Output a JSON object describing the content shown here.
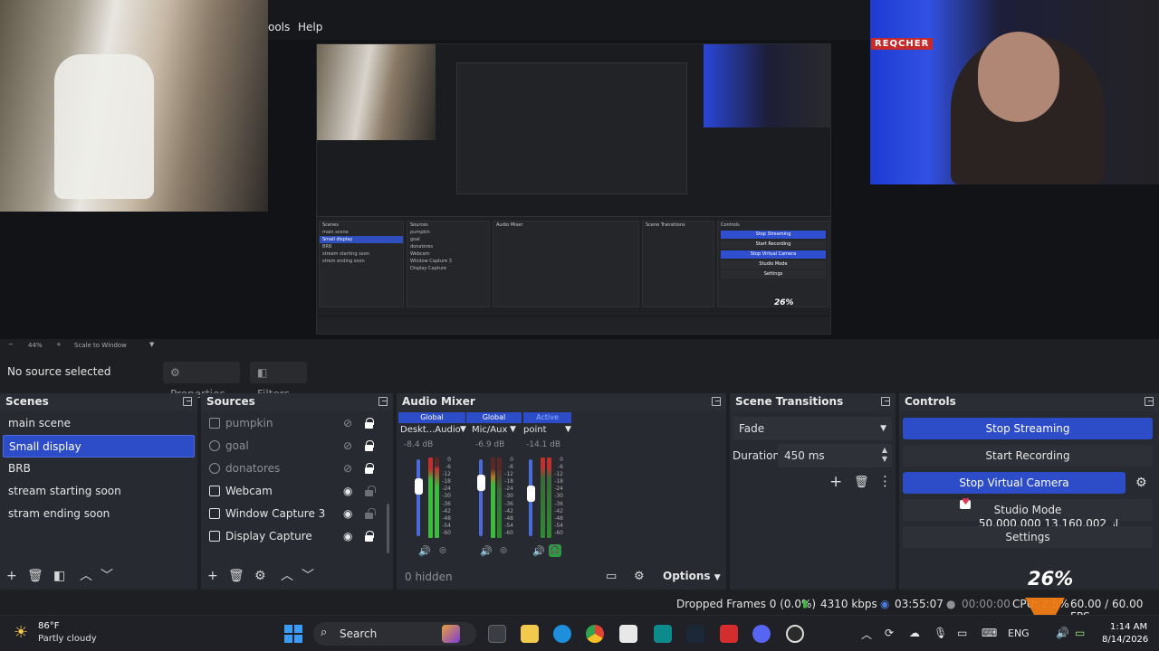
{
  "menu": {
    "tools_fragment": "ools",
    "help": "Help"
  },
  "camera": {
    "tag": "REQCHER"
  },
  "inner_preview": {
    "scenes_title": "Scenes",
    "sources_title": "Sources",
    "mixer_title": "Audio Mixer",
    "transitions_title": "Scene Transitions",
    "controls_title": "Controls",
    "scenes": [
      "main scene",
      "Small display",
      "BRB",
      "stream starting soon",
      "strem ending soon"
    ],
    "sources": [
      "pumpkin",
      "goal",
      "donatores",
      "Webcam",
      "Window Capture 3",
      "Display Capture"
    ],
    "controls": [
      "Stop Streaming",
      "Start Recording",
      "Stop Virtual Camera",
      "Studio Mode",
      "Settings"
    ],
    "percent": "26%"
  },
  "zoom": {
    "minus": "−",
    "level": "44%",
    "plus": "+",
    "mode": "Scale to Window"
  },
  "context": {
    "no_source": "No source selected",
    "properties": "Properties",
    "filters": "Filters"
  },
  "scenes": {
    "title": "Scenes",
    "items": [
      "main scene",
      "Small display",
      "BRB",
      "stream starting soon",
      "stram ending soon"
    ]
  },
  "sources": {
    "title": "Sources",
    "items": [
      {
        "label": "pumpkin",
        "icon": "image-icon"
      },
      {
        "label": "goal",
        "icon": "browser-icon"
      },
      {
        "label": "donatores",
        "icon": "browser-icon"
      },
      {
        "label": "Webcam",
        "icon": "camera-icon"
      },
      {
        "label": "Window Capture 3",
        "icon": "window-icon"
      },
      {
        "label": "Display Capture",
        "icon": "monitor-icon"
      }
    ]
  },
  "mixer": {
    "title": "Audio Mixer",
    "channels": [
      {
        "tag": "Global",
        "name": "Deskt...Audio",
        "db": "-8.4 dB"
      },
      {
        "tag": "Global",
        "name": "Mic/Aux",
        "db": "-6.9 dB"
      },
      {
        "tag": "Active",
        "name": "point",
        "db": "-14.1 dB"
      }
    ],
    "scale": [
      "0",
      "-6",
      "-12",
      "-18",
      "-24",
      "-30",
      "-36",
      "-42",
      "-48",
      "-54",
      "-60"
    ],
    "hidden": "0 hidden",
    "options": "Options"
  },
  "transitions": {
    "title": "Scene Transitions",
    "selected": "Fade",
    "duration_label": "Duration",
    "duration_value": "450 ms"
  },
  "controls": {
    "title": "Controls",
    "stop_streaming": "Stop Streaming",
    "start_recording": "Start Recording",
    "stop_virtual_camera": "Stop Virtual Camera",
    "studio_mode": "Studio Mode",
    "overlay_line": "50,000,000 از 13,160,002 تومان",
    "settings": "Settings",
    "cpu_overlay": "26%"
  },
  "status": {
    "dropped_frames": "Dropped Frames 0 (0.0%)",
    "bitrate": "4310 kbps",
    "stream_time": "03:55:07",
    "record_time": "00:00:00",
    "cpu": "CPU: 2.5%",
    "fps": "60.00 / 60.00 FPS"
  },
  "taskbar": {
    "temperature": "86°F",
    "weather": "Partly cloudy",
    "search": "Search",
    "language": "ENG",
    "time": "1:14 AM",
    "date": "8/14/2026"
  },
  "colors": {
    "accent": "#2d4cc7",
    "panel": "#272a30",
    "background": "#1e1f22"
  }
}
